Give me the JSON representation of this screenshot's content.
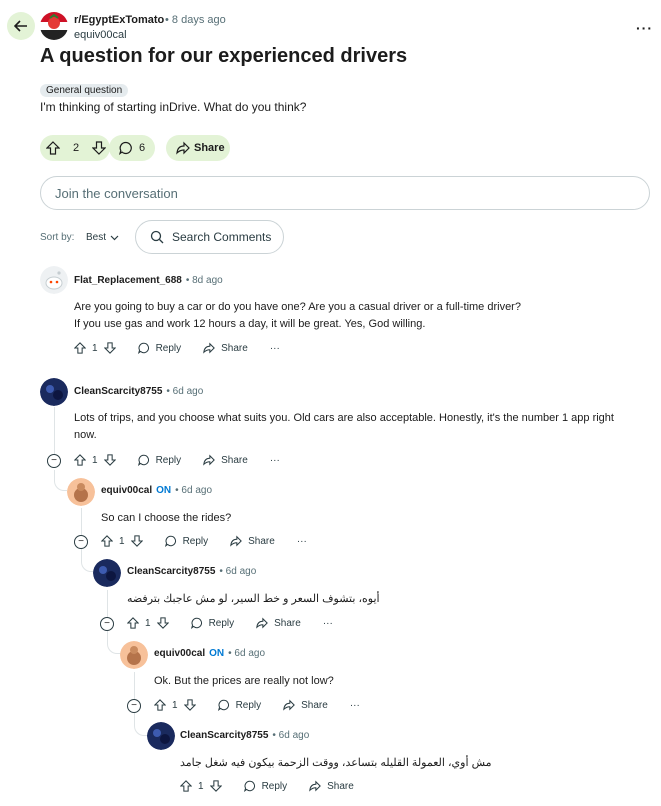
{
  "post": {
    "subreddit": "r/EgyptExTomato",
    "age": "• 8 days ago",
    "author": "equiv00cal",
    "title": "A question for our experienced drivers",
    "flair": "General question",
    "body": "I'm thinking of starting inDrive. What do you think?",
    "votes": "2",
    "comments": "6",
    "share_label": "Share"
  },
  "composer": {
    "placeholder": "Join the conversation"
  },
  "sort": {
    "label": "Sort by:",
    "value": "Best"
  },
  "search": {
    "placeholder": "Search Comments"
  },
  "actions": {
    "reply": "Reply",
    "share": "Share",
    "more": "···"
  },
  "comments": [
    {
      "user": "Flat_Replacement_688",
      "time": "• 8d ago",
      "text1": "Are you going to buy a car or do you have one? Are you a casual driver or a full-time driver?",
      "text2": "If you use gas and work 12 hours a day, it will be great. Yes, God willing.",
      "votes": "1"
    },
    {
      "user": "CleanScarcity8755",
      "time": "• 6d ago",
      "text1": "Lots of trips, and you choose what suits you. Old cars are also acceptable. Honestly, it's the number 1 app right",
      "text2": "now.",
      "votes": "1"
    },
    {
      "user": "equiv00cal",
      "on": "ON",
      "time": "• 6d ago",
      "text1": "So can I choose the rides?",
      "votes": "1"
    },
    {
      "user": "CleanScarcity8755",
      "time": "• 6d ago",
      "text1": "أيوه، بتشوف السعر و خط السير، لو مش عاجبك بترفضه",
      "votes": "1"
    },
    {
      "user": "equiv00cal",
      "on": "ON",
      "time": "• 6d ago",
      "text1": "Ok. But the prices are really not low?",
      "votes": "1"
    },
    {
      "user": "CleanScarcity8755",
      "time": "• 6d ago",
      "text1": "مش أوي، العمولة القليله بتساعد، ووقت الزحمة بيكون فيه شغل جامد",
      "votes": "1"
    }
  ],
  "colors": {
    "accent": "#e3f3d6",
    "link": "#0079d3",
    "muted": "#576f76"
  }
}
